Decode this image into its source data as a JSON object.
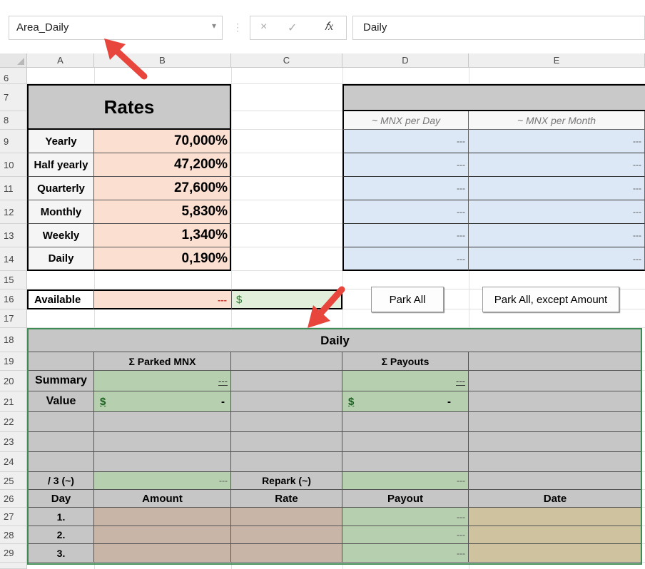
{
  "formula_bar": {
    "name_box": "Area_Daily",
    "name_box_dropdown_icon": "dropdown-triangle",
    "cancel_icon": "×",
    "enter_icon": "✓",
    "fx_icon": "fx",
    "formula": "Daily"
  },
  "columns": [
    "A",
    "B",
    "C",
    "D",
    "E"
  ],
  "rows": [
    "6",
    "7",
    "8",
    "9",
    "10",
    "11",
    "12",
    "13",
    "14",
    "15",
    "16",
    "17",
    "18",
    "19",
    "20",
    "21",
    "22",
    "23",
    "24",
    "25",
    "26",
    "27",
    "28",
    "29"
  ],
  "rates": {
    "title": "Rates",
    "items": [
      {
        "label": "Yearly",
        "value": "70,000%"
      },
      {
        "label": "Half yearly",
        "value": "47,200%"
      },
      {
        "label": "Quarterly",
        "value": "27,600%"
      },
      {
        "label": "Monthly",
        "value": "5,830%"
      },
      {
        "label": "Weekly",
        "value": "1,340%"
      },
      {
        "label": "Daily",
        "value": "0,190%"
      }
    ]
  },
  "mnx": {
    "per_day": "~ MNX per Day",
    "per_month": "~ MNX per Month",
    "placeholder": "---"
  },
  "available": {
    "label": "Available",
    "value": "---",
    "currency": "$"
  },
  "buttons": {
    "park_all": "Park All",
    "park_all_except": "Park All, except Amount"
  },
  "daily": {
    "title": "Daily",
    "parked_header": "Σ Parked MNX",
    "payouts_header": "Σ Payouts",
    "summary_label": "Summary",
    "value_label": "Value",
    "summary_parked": "---",
    "summary_payouts": "---",
    "currency": "$",
    "value_dash": "-",
    "third_label": "/ 3 (~)",
    "third_value": "---",
    "repark_label": "Repark (~)",
    "repark_value": "---",
    "table_headers": [
      "Day",
      "Amount",
      "Rate",
      "Payout",
      "Date"
    ],
    "table_rows": [
      {
        "day": "1.",
        "payout": "---"
      },
      {
        "day": "2.",
        "payout": "---"
      },
      {
        "day": "3.",
        "payout": "---"
      }
    ]
  },
  "colors": {
    "arrow": "#e8453c",
    "selection_border": "#3d8a52",
    "rates_value_bg": "#fbe0d2",
    "mnx_cell_bg": "#dce8f6"
  }
}
